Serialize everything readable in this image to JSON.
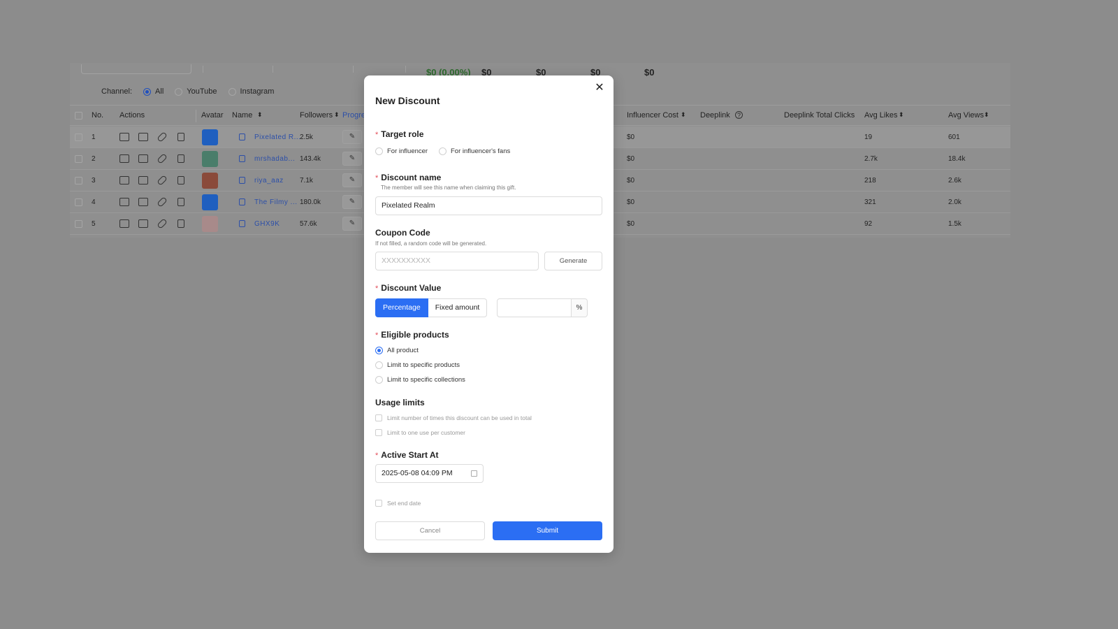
{
  "background": {
    "summary_values": [
      "$0 (0.00%)",
      "$0",
      "$0",
      "$0",
      "$0"
    ],
    "channel": {
      "label": "Channel:",
      "options": [
        "All",
        "YouTube",
        "Instagram"
      ],
      "selected": "All"
    },
    "table": {
      "headers": {
        "no": "No.",
        "actions": "Actions",
        "avatar": "Avatar",
        "name": "Name",
        "followers": "Followers",
        "progress": "Progre",
        "influencer_cost": "Influencer Cost",
        "deeplink": "Deeplink",
        "deeplink_total_clicks": "Deeplink Total Clicks",
        "avg_likes": "Avg Likes",
        "avg_views": "Avg Views"
      },
      "rows": [
        {
          "no": "1",
          "name": "Pixelated R...",
          "followers": "2.5k",
          "cost": "$0",
          "likes": "19",
          "views": "601",
          "avatar_color": "#1f5fbf"
        },
        {
          "no": "2",
          "name": "mrshadab...",
          "followers": "143.4k",
          "cost": "$0",
          "likes": "2.7k",
          "views": "18.4k",
          "avatar_color": "#4a7d6a"
        },
        {
          "no": "3",
          "name": "riya_aaz",
          "followers": "7.1k",
          "cost": "$0",
          "likes": "218",
          "views": "2.6k",
          "avatar_color": "#8a4a3a"
        },
        {
          "no": "4",
          "name": "The Filmy ...",
          "followers": "180.0k",
          "cost": "$0",
          "likes": "321",
          "views": "2.0k",
          "avatar_color": "#1f5fbf"
        },
        {
          "no": "5",
          "name": "GHX9K",
          "followers": "57.6k",
          "cost": "$0",
          "likes": "92",
          "views": "1.5k",
          "avatar_color": "#a88a8a"
        }
      ]
    }
  },
  "modal": {
    "title": "New Discount",
    "close_icon": "close-icon",
    "target_role": {
      "label": "Target role",
      "options": [
        "For influencer",
        "For influencer's fans"
      ]
    },
    "discount_name": {
      "label": "Discount name",
      "hint": "The member will see this name when claiming this gift.",
      "value": "Pixelated Realm"
    },
    "coupon_code": {
      "label": "Coupon Code",
      "hint": "If not filled, a random code will be generated.",
      "placeholder": "XXXXXXXXXX",
      "generate_label": "Generate"
    },
    "discount_value": {
      "label": "Discount Value",
      "types": [
        "Percentage",
        "Fixed amount"
      ],
      "selected_type": "Percentage",
      "value": "",
      "suffix": "%"
    },
    "eligible_products": {
      "label": "Eligible products",
      "options": [
        "All product",
        "Limit to specific products",
        "Limit to specific collections"
      ],
      "selected": "All product"
    },
    "usage_limits": {
      "label": "Usage limits",
      "options": [
        "Limit number of times this discount can be used in total",
        "Limit to one use per customer"
      ]
    },
    "active_start": {
      "label": "Active Start At",
      "value": "2025-05-08 04:09 PM"
    },
    "set_end_date_label": "Set end date",
    "cancel_label": "Cancel",
    "submit_label": "Submit",
    "accent_color": "#2b6ef3",
    "required_color": "#e34d59"
  }
}
